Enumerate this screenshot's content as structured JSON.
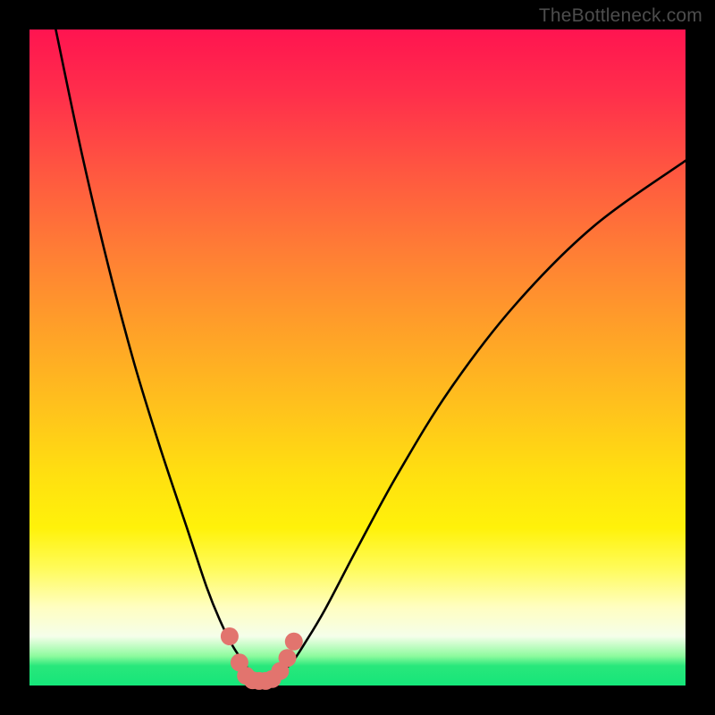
{
  "watermark": "TheBottleneck.com",
  "colors": {
    "frame": "#000000",
    "curve_stroke": "#000000",
    "marker_fill": "#e2746e",
    "gradient_top": "#ff1450",
    "gradient_bottom": "#15e67a"
  },
  "chart_data": {
    "type": "line",
    "title": "",
    "xlabel": "",
    "ylabel": "",
    "xlim": [
      0,
      100
    ],
    "ylim": [
      0,
      100
    ],
    "grid": false,
    "legend": false,
    "note": "V-shaped bottleneck curve. x and y are percent of plot width/height measured from top-left; minimum (y≈100) around x≈35.",
    "series": [
      {
        "name": "bottleneck-curve",
        "x": [
          4,
          8,
          12,
          16,
          20,
          24,
          27,
          29,
          31,
          33,
          34,
          35,
          36,
          37,
          38,
          40,
          42,
          45,
          50,
          56,
          64,
          74,
          86,
          100
        ],
        "y": [
          0,
          19,
          36,
          51,
          64,
          76,
          85,
          90,
          94,
          97,
          98.5,
          99.2,
          99.3,
          99.0,
          98.3,
          96.5,
          93.5,
          88.5,
          79,
          68,
          55,
          42,
          30,
          20
        ]
      }
    ],
    "markers": {
      "name": "highlight-dots",
      "x_pct": [
        30.5,
        32.0,
        33.0,
        34.0,
        35.0,
        36.0,
        37.0,
        38.2,
        39.3,
        40.3
      ],
      "y_pct": [
        92.5,
        96.5,
        98.5,
        99.2,
        99.3,
        99.3,
        99.0,
        97.8,
        95.8,
        93.3
      ],
      "radius_px": 10
    }
  }
}
